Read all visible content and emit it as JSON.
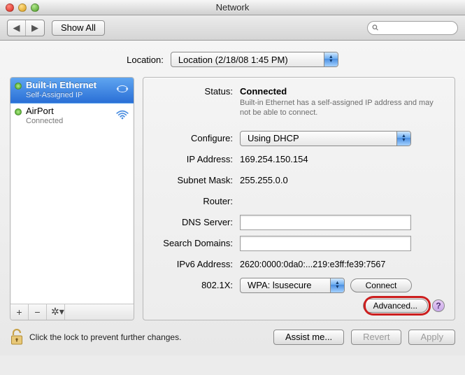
{
  "window": {
    "title": "Network"
  },
  "toolbar": {
    "show_all": "Show All",
    "search_placeholder": ""
  },
  "location": {
    "label": "Location:",
    "selected": "Location (2/18/08 1:45 PM)"
  },
  "sidebar": {
    "items": [
      {
        "name": "Built-in Ethernet",
        "status": "Self-Assigned IP",
        "selected": true,
        "kind": "ethernet"
      },
      {
        "name": "AirPort",
        "status": "Connected",
        "selected": false,
        "kind": "wifi"
      }
    ]
  },
  "details": {
    "status_label": "Status:",
    "status_value": "Connected",
    "status_desc": "Built-in Ethernet has a self-assigned IP address and may not be able to connect.",
    "configure_label": "Configure:",
    "configure_value": "Using DHCP",
    "ip_label": "IP Address:",
    "ip_value": "169.254.150.154",
    "subnet_label": "Subnet Mask:",
    "subnet_value": "255.255.0.0",
    "router_label": "Router:",
    "router_value": "",
    "dns_label": "DNS Server:",
    "dns_value": "",
    "search_label": "Search Domains:",
    "search_value": "",
    "ipv6_label": "IPv6 Address:",
    "ipv6_value": "2620:0000:0da0:...219:e3ff:fe39:7567",
    "wpa_label": "802.1X:",
    "wpa_value": "WPA: lsusecure",
    "connect_label": "Connect",
    "advanced_label": "Advanced..."
  },
  "bottom": {
    "lock_text": "Click the lock to prevent further changes.",
    "assist": "Assist me...",
    "revert": "Revert",
    "apply": "Apply"
  }
}
